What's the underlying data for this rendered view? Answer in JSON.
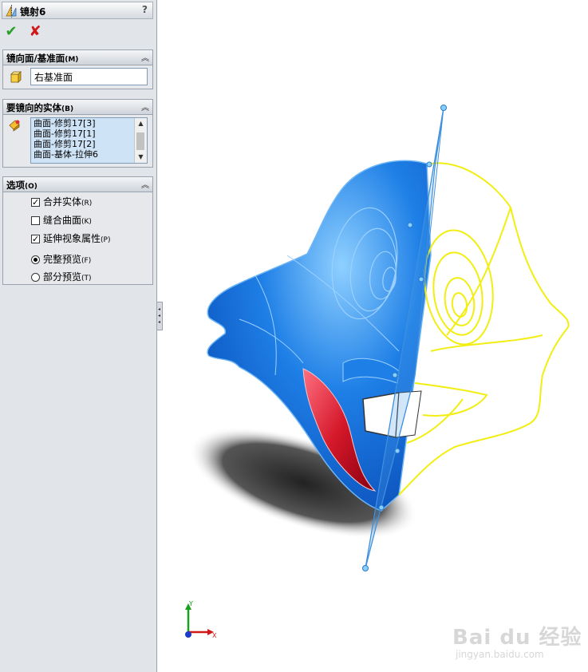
{
  "feature": {
    "title": "镜射6",
    "help": "?",
    "icon": "mirror-icon"
  },
  "actions": {
    "ok": "✔",
    "cancel": "✘"
  },
  "mirror_face": {
    "title": "镜向面/基准面",
    "shortcut": "(M)",
    "value": "右基准面",
    "icon": "plane-icon"
  },
  "bodies": {
    "title": "要镜向的实体",
    "shortcut": "(B)",
    "items": [
      "曲面-修剪17[3]",
      "曲面-修剪17[1]",
      "曲面-修剪17[2]",
      "曲面-基体-拉伸6"
    ],
    "icon": "body-select-icon"
  },
  "options": {
    "title": "选项",
    "shortcut": "(O)",
    "merge": {
      "label": "合并实体",
      "key": "(R)",
      "checked": true
    },
    "knit": {
      "label": "缝合曲面",
      "key": "(K)",
      "checked": false
    },
    "propagate": {
      "label": "延伸视象属性",
      "key": "(P)",
      "checked": true
    },
    "full_preview": {
      "label": "完整预览",
      "key": "(F)",
      "selected": true
    },
    "partial_preview": {
      "label": "部分预览",
      "key": "(T)",
      "selected": false
    }
  },
  "triad": {
    "x": "X",
    "y": "Y"
  },
  "watermark": {
    "brand": "Bai du 经验",
    "url": "jingyan.baidu.com"
  },
  "colors": {
    "model_blue": "#1e7fe6",
    "mirror_yellow": "#f2ee12",
    "mouth_red": "#d4182a"
  }
}
